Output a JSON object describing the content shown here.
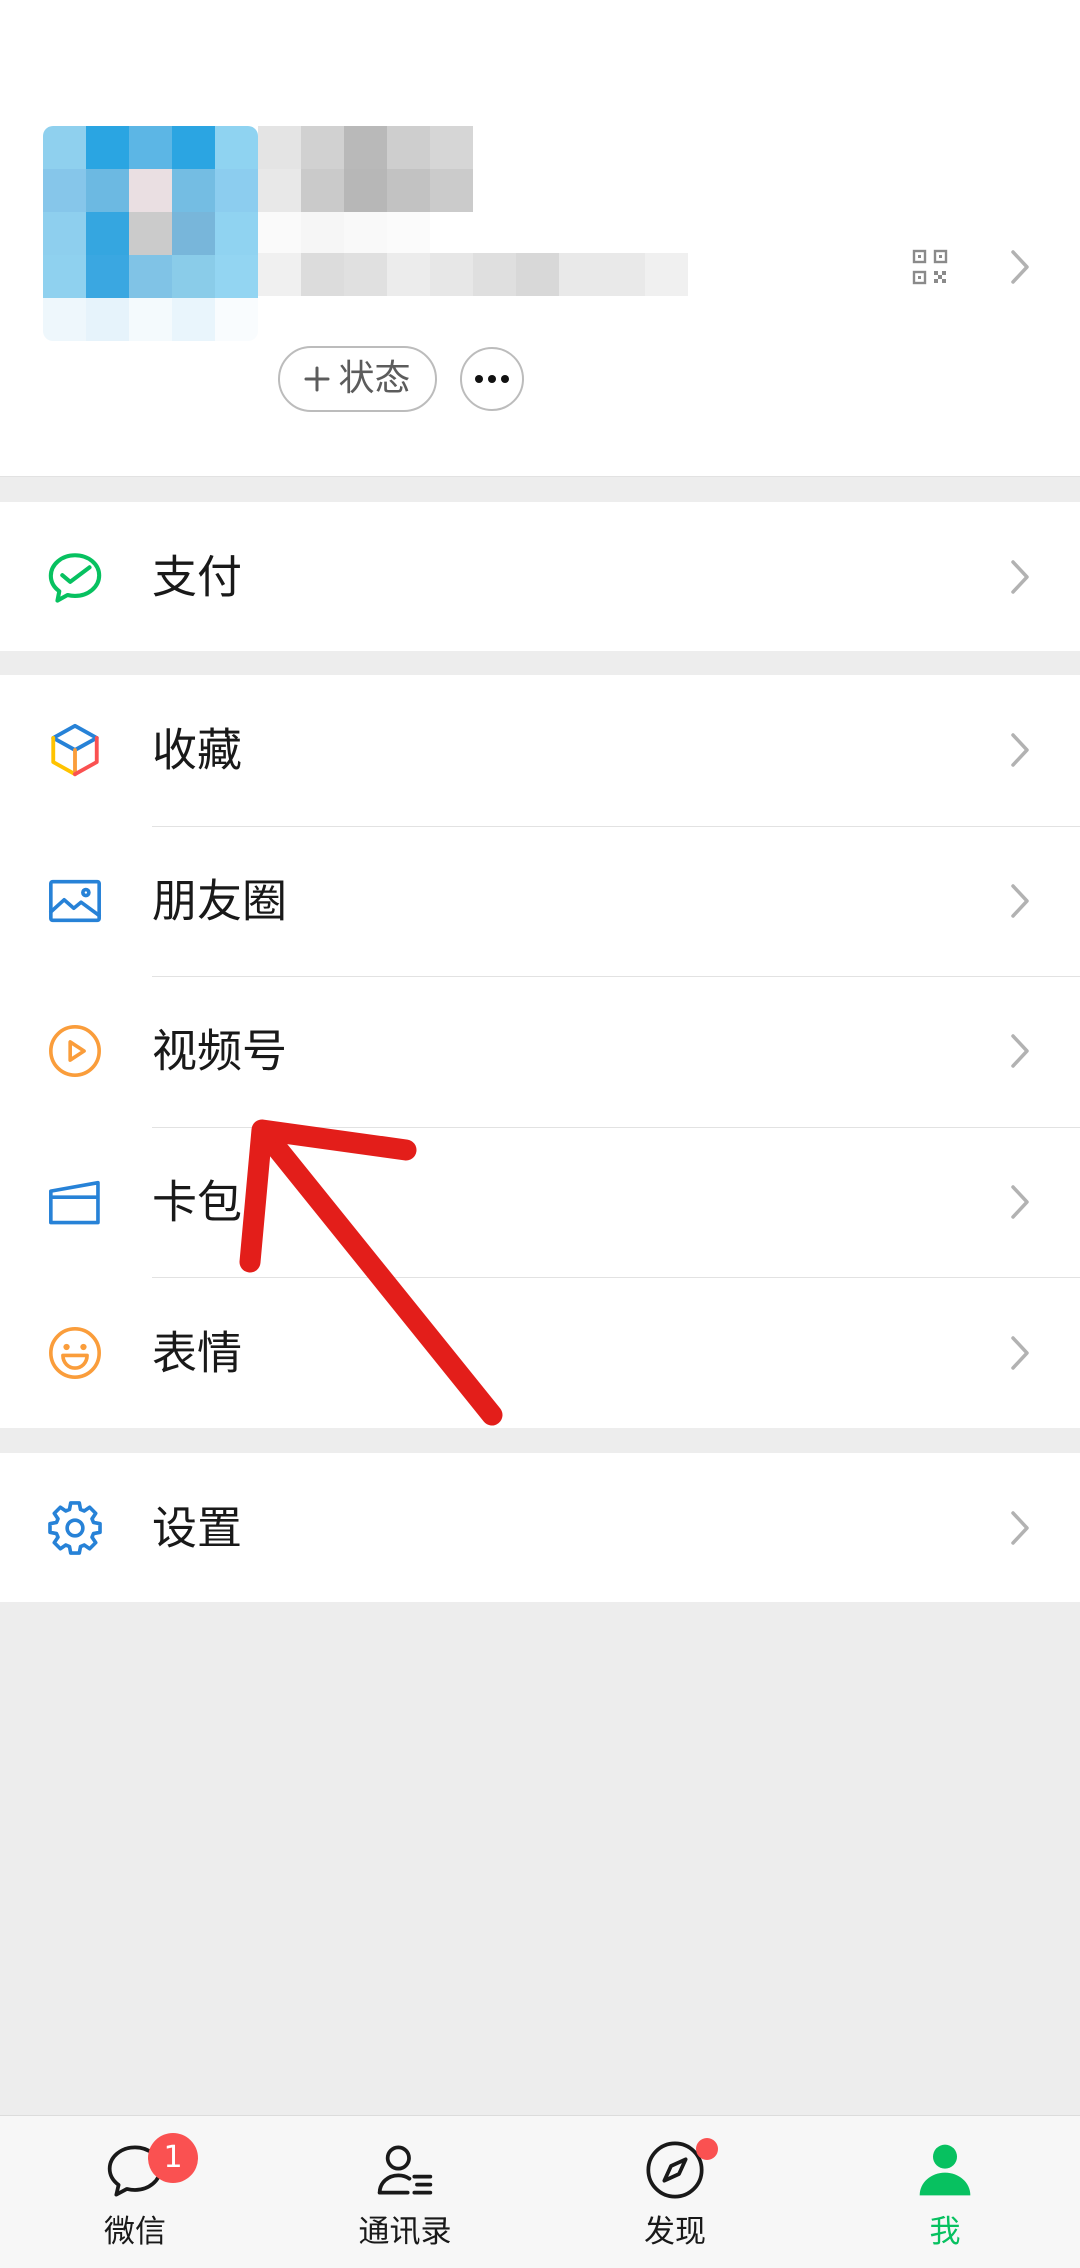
{
  "profile": {
    "status_button_label": "状态",
    "status_button_icon": "plus-icon",
    "more_button_icon": "more-icon",
    "qr_icon": "qr-code-icon",
    "chevron_icon": "chevron-right-icon"
  },
  "menu": {
    "pay": {
      "label": "支付",
      "icon": "pay-icon"
    },
    "favorites": {
      "label": "收藏",
      "icon": "favorites-icon"
    },
    "moments": {
      "label": "朋友圈",
      "icon": "moments-icon"
    },
    "channels": {
      "label": "视频号",
      "icon": "channels-icon"
    },
    "cards": {
      "label": "卡包",
      "icon": "card-icon"
    },
    "stickers": {
      "label": "表情",
      "icon": "sticker-icon"
    },
    "settings": {
      "label": "设置",
      "icon": "settings-icon"
    }
  },
  "tabbar": {
    "tabs": [
      {
        "label": "微信",
        "icon": "chat-icon",
        "badge": "1"
      },
      {
        "label": "通讯录",
        "icon": "contacts-icon"
      },
      {
        "label": "发现",
        "icon": "discover-icon",
        "dot": true
      },
      {
        "label": "我",
        "icon": "me-icon",
        "active": true
      }
    ]
  },
  "colors": {
    "accent_green": "#07c160",
    "badge_red": "#fa5151",
    "icon_blue": "#2782d7",
    "icon_orange": "#fa9d3b",
    "annotation_red": "#e31e1a"
  }
}
